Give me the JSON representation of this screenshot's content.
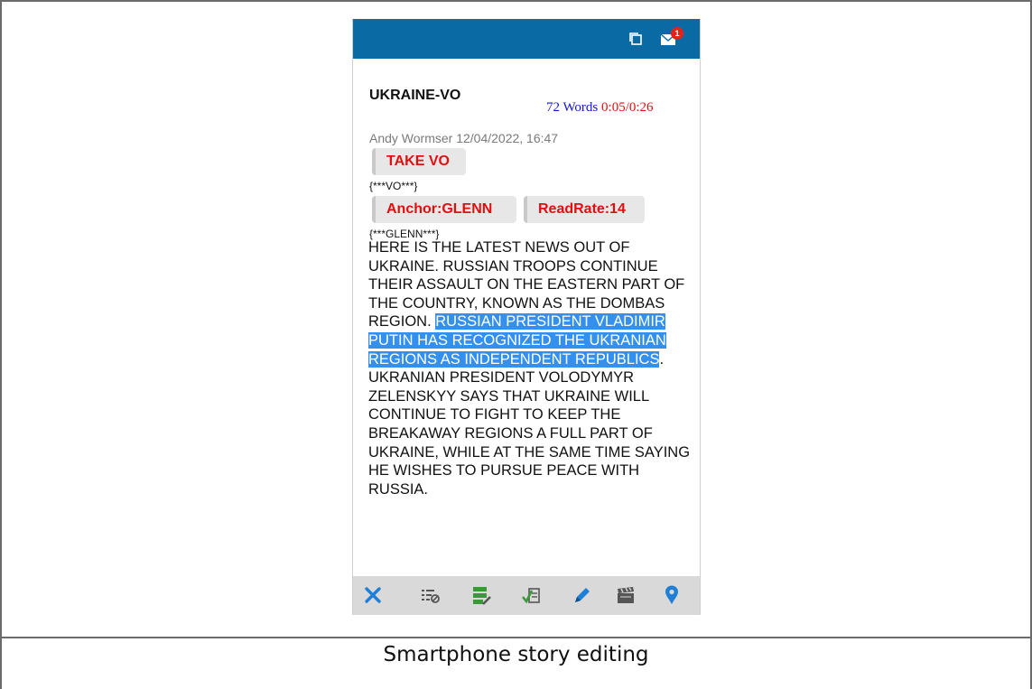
{
  "header": {
    "copy_icon": "copy-icon",
    "mail_icon": "mail-icon",
    "mail_badge": "1"
  },
  "story": {
    "title": "UKRAINE-VO",
    "word_count": "72 Words",
    "timing": "0:05/0:26",
    "byline": "Andy Wormser 12/04/2022, 16:47",
    "take_chip": "TAKE VO",
    "vo_tag": "{***VO***}",
    "anchor_chip": "Anchor:GLENN",
    "readrate_chip": "ReadRate:14",
    "anchor_tag": "{***GLENN***}",
    "body_before": "HERE IS THE LATEST NEWS OUT OF UKRAINE. RUSSIAN TROOPS CONTINUE THEIR ASSAULT ON THE EASTERN PART OF THE COUNTRY, KNOWN AS THE DOMBAS REGION. ",
    "body_selected": "RUSSIAN PRESIDENT VLADIMIR PUTIN HAS RECOGNIZED THE UKRANIAN REGIONS AS INDEPENDENT REPUBLICS",
    "body_after": ". UKRANIAN PRESIDENT VOLODYMYR ZELENSKYY SAYS THAT UKRAINE WILL CONTINUE TO FIGHT TO KEEP THE BREAKAWAY REGIONS A FULL PART OF UKRAINE, WHILE AT THE SAME TIME SAYING HE WISHES TO PURSUE PEACE WITH RUSSIA."
  },
  "toolbar": {
    "icons": [
      "close-icon",
      "list-settings-icon",
      "server-edit-icon",
      "script-check-icon",
      "pencil-icon",
      "clapperboard-icon",
      "location-pin-icon"
    ]
  },
  "caption": "Smartphone story editing",
  "colors": {
    "topbar": "#0a6aa3",
    "word_count": "#1515d6",
    "timing": "#e01010",
    "chip_text": "#e01010",
    "selection": "#3390ef",
    "toolbar_bg": "#d9d9d9"
  }
}
